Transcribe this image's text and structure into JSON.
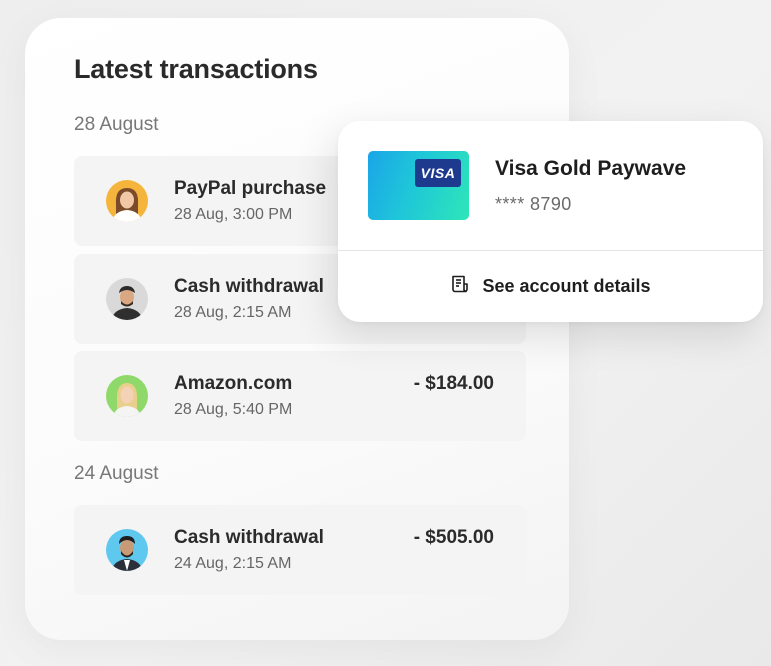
{
  "panel": {
    "title": "Latest transactions",
    "groups": [
      {
        "date": "28 August",
        "transactions": [
          {
            "name": "PayPal purchase",
            "time": "28 Aug, 3:00 PM",
            "amount": "",
            "avatar_bg": "#f5b43c"
          },
          {
            "name": "Cash withdrawal",
            "time": "28 Aug, 2:15 AM",
            "amount": "",
            "avatar_bg": "#d9d9d9"
          },
          {
            "name": "Amazon.com",
            "time": "28 Aug, 5:40 PM",
            "amount": "- $184.00",
            "avatar_bg": "#8fd96a"
          }
        ]
      },
      {
        "date": "24 August",
        "transactions": [
          {
            "name": "Cash withdrawal",
            "time": "24 Aug, 2:15 AM",
            "amount": "- $505.00",
            "avatar_bg": "#5ec8ee"
          }
        ]
      }
    ]
  },
  "card": {
    "title": "Visa Gold Paywave",
    "number": "**** 8790",
    "brand": "VISA",
    "details_label": "See account details",
    "details_icon": "receipt-icon"
  }
}
